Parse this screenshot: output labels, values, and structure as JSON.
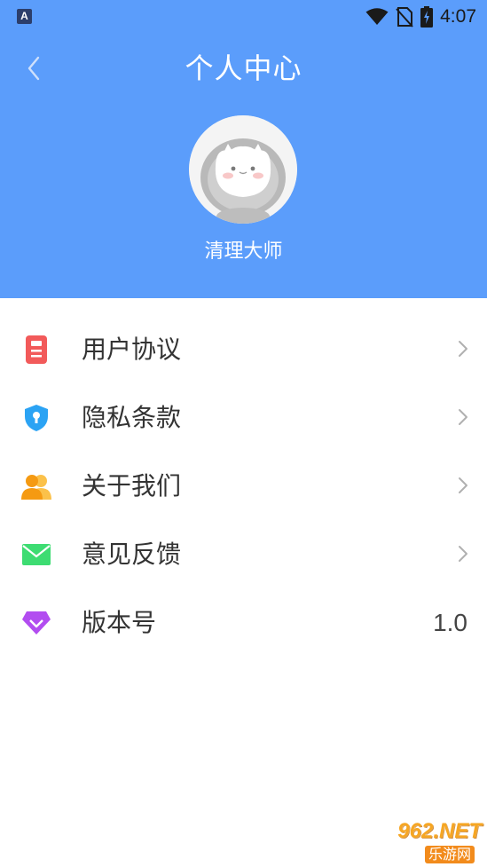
{
  "status_bar": {
    "app_badge": "A",
    "time": "4:07"
  },
  "header": {
    "title": "个人中心",
    "username": "清理大师"
  },
  "menu": {
    "items": [
      {
        "label": "用户协议",
        "icon": "document-icon",
        "color": "#f25a5a"
      },
      {
        "label": "隐私条款",
        "icon": "shield-icon",
        "color": "#2ba3f4"
      },
      {
        "label": "关于我们",
        "icon": "users-icon",
        "color": "#f7a81b"
      },
      {
        "label": "意见反馈",
        "icon": "mail-icon",
        "color": "#3ddc72"
      },
      {
        "label": "版本号",
        "icon": "diamond-icon",
        "color": "#b24df0",
        "value": "1.0"
      }
    ]
  },
  "watermark": {
    "brand": "962.NET",
    "sub": "乐游网"
  },
  "colors": {
    "header_bg": "#5b9dfb",
    "text_primary": "#333333"
  }
}
